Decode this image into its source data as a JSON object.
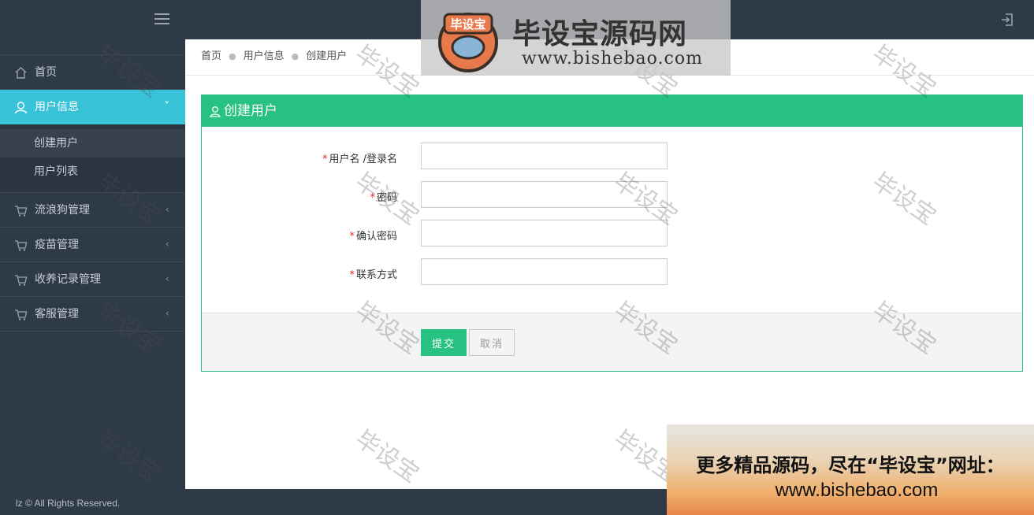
{
  "topbar": {
    "menu_icon": "hamburger-icon",
    "logout_icon": "logout-icon"
  },
  "logo": {
    "badge": "毕设宝",
    "title": "毕设宝源码网",
    "url": "www.bishebao.com"
  },
  "sidebar": {
    "items": [
      {
        "label": "首页",
        "icon": "home-icon"
      },
      {
        "label": "用户信息",
        "icon": "user-icon",
        "active": true,
        "chevron": "˅"
      },
      {
        "label": "流浪狗管理",
        "icon": "cart-icon",
        "chevron": "‹"
      },
      {
        "label": "疫苗管理",
        "icon": "cart-icon",
        "chevron": "‹"
      },
      {
        "label": "收养记录管理",
        "icon": "cart-icon",
        "chevron": "‹"
      },
      {
        "label": "客服管理",
        "icon": "cart-icon",
        "chevron": "‹"
      }
    ],
    "subitems": [
      {
        "label": "创建用户",
        "active": true
      },
      {
        "label": "用户列表"
      }
    ]
  },
  "breadcrumb": {
    "home": "首页",
    "section": "用户信息",
    "current": "创建用户"
  },
  "panel": {
    "title": "创建用户",
    "icon": "user-icon"
  },
  "form": {
    "required_mark": "*",
    "fields": [
      {
        "label": "用户名 /登录名",
        "value": "",
        "type": "text"
      },
      {
        "label": "密码",
        "value": "",
        "type": "password"
      },
      {
        "label": "确认密码",
        "value": "",
        "type": "password"
      },
      {
        "label": "联系方式",
        "value": "",
        "type": "text"
      }
    ],
    "submit_label": "提交",
    "cancel_label": "取消"
  },
  "footer": {
    "text": "lz © All Rights Reserved."
  },
  "watermark": {
    "text": "毕设宝"
  },
  "ad": {
    "line1": "更多精品源码，尽在“毕设宝”网址：",
    "line2": "www.bishebao.com"
  },
  "colors": {
    "sidebar_bg": "#2f3a48",
    "active_nav": "#39c3d8",
    "panel_green": "#27c281",
    "required": "#e5242a"
  }
}
